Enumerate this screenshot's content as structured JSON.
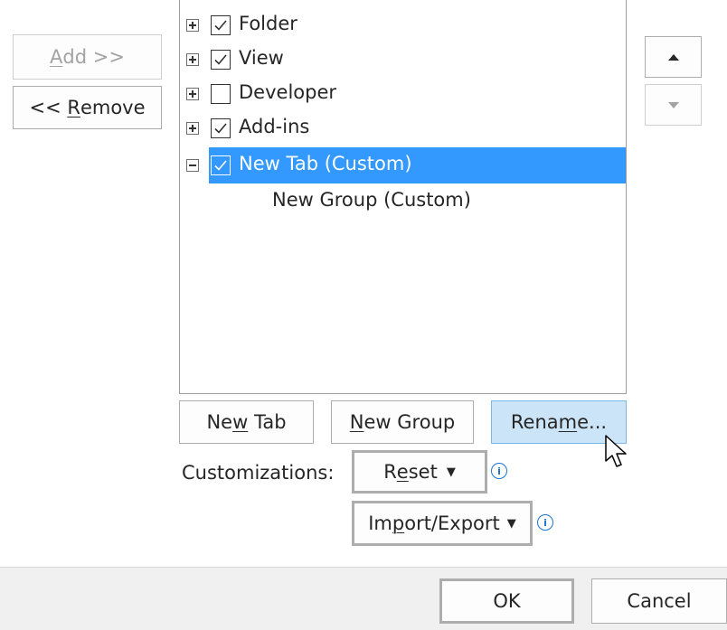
{
  "left_buttons": {
    "add_label_u": "A",
    "add_label_rest": "dd >>",
    "remove_label_pre": "<< ",
    "remove_label_u": "R",
    "remove_label_rest": "emove"
  },
  "tree": {
    "items": [
      {
        "label": "Folder",
        "checked": true,
        "expanded": false
      },
      {
        "label": "View",
        "checked": true,
        "expanded": false
      },
      {
        "label": "Developer",
        "checked": false,
        "expanded": false
      },
      {
        "label": "Add-ins",
        "checked": true,
        "expanded": false
      },
      {
        "label": "New Tab (Custom)",
        "checked": true,
        "expanded": true,
        "selected": true
      }
    ],
    "child": {
      "label": "New Group (Custom)"
    }
  },
  "order_buttons": {
    "up_icon": "triangle-up-icon",
    "down_icon": "triangle-down-icon"
  },
  "actions": {
    "new_tab_pre": "Ne",
    "new_tab_u": "w",
    "new_tab_rest": " Tab",
    "new_group_u": "N",
    "new_group_rest": "ew Group",
    "rename_pre": "Rena",
    "rename_u": "m",
    "rename_rest": "e..."
  },
  "customizations": {
    "label": "Customizations:",
    "reset_pre": "R",
    "reset_u": "e",
    "reset_rest": "set",
    "import_pre": "Im",
    "import_u": "p",
    "import_rest": "ort/Export",
    "dropdown_glyph": "▼",
    "info_glyph": "i"
  },
  "dialog_buttons": {
    "ok": "OK",
    "cancel": "Cancel"
  },
  "colors": {
    "selection": "#3399ff",
    "hover_button": "#cce4f7",
    "info_icon": "#1e73c8"
  }
}
